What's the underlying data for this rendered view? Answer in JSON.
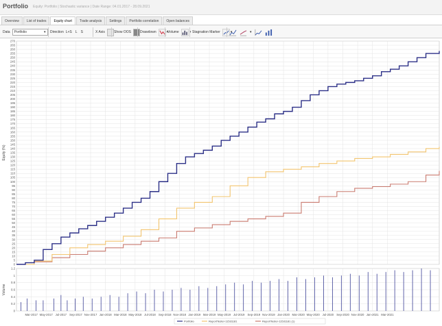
{
  "window": {
    "title": "Portfolio",
    "subtitle": "Equity: Portfolio | Stochastic variance | Date Range: 04.01.2017 - 28.09.2021"
  },
  "tabs": [
    {
      "label": "Overview",
      "active": false
    },
    {
      "label": "List of trades",
      "active": false
    },
    {
      "label": "Equity chart",
      "active": true
    },
    {
      "label": "Trade analysis",
      "active": false
    },
    {
      "label": "Settings",
      "active": false
    },
    {
      "label": "Portfolio correlation",
      "active": false
    },
    {
      "label": "Open balances",
      "active": false
    }
  ],
  "toolbar": {
    "data_label": "Data",
    "data_value": "Portfolio",
    "direction_label": "Direction",
    "direction_values": [
      "L+S",
      "L",
      "S"
    ],
    "xaxis_label": "X Axis",
    "show_oos_label": "Show OOS",
    "drawdown_label": "Drawdown",
    "volume_label": "Volume",
    "stagnation_label": "Stagnation Marker"
  },
  "colors": {
    "portfolio": "#2b2f86",
    "series2": "#f2c46e",
    "series3": "#c97a6f",
    "volume_bar": "#3a3f95",
    "grid": "#e3e3e3"
  },
  "chart_data": [
    {
      "type": "line",
      "ylabel": "Equity (%)",
      "ylim": [
        0,
        270
      ],
      "yticks": [
        0,
        5,
        10,
        15,
        20,
        25,
        30,
        35,
        40,
        45,
        50,
        55,
        60,
        65,
        70,
        75,
        80,
        85,
        90,
        95,
        100,
        105,
        110,
        115,
        120,
        125,
        130,
        135,
        140,
        145,
        150,
        155,
        160,
        165,
        170,
        175,
        180,
        185,
        190,
        195,
        200,
        205,
        210,
        215,
        220,
        225,
        230,
        235,
        240,
        245,
        250,
        255,
        260,
        265,
        270
      ],
      "xlim": [
        2017.0,
        2021.75
      ],
      "x_tick_labels": [
        "Mar-2017",
        "May-2017",
        "Jul-2017",
        "Sep-2017",
        "Nov-2017",
        "Jan-2018",
        "Mar-2018",
        "May-2018",
        "Jul-2018",
        "Sep-2018",
        "Nov-2018",
        "Jan-2019",
        "Mar-2019",
        "May-2019",
        "Jul-2019",
        "Sep-2019",
        "Nov-2019",
        "Jan-2020",
        "Mar-2020",
        "May-2020",
        "Jul-2020",
        "Sep-2020",
        "Nov-2020",
        "Jan-2021",
        "Mar-2021"
      ],
      "x_tick_values": [
        2017.167,
        2017.333,
        2017.5,
        2017.667,
        2017.833,
        2018.0,
        2018.167,
        2018.333,
        2018.5,
        2018.667,
        2018.833,
        2019.0,
        2019.167,
        2019.333,
        2019.5,
        2019.667,
        2019.833,
        2020.0,
        2020.167,
        2020.333,
        2020.5,
        2020.667,
        2020.833,
        2021.0,
        2021.167
      ],
      "grid": true,
      "legend": "bottom-right",
      "series": [
        {
          "name": "Portfolio",
          "color_key": "portfolio",
          "x": [
            2017.0,
            2017.1,
            2017.2,
            2017.3,
            2017.4,
            2017.5,
            2017.6,
            2017.7,
            2017.8,
            2017.9,
            2018.0,
            2018.1,
            2018.2,
            2018.3,
            2018.4,
            2018.5,
            2018.6,
            2018.7,
            2018.8,
            2018.9,
            2019.0,
            2019.1,
            2019.2,
            2019.3,
            2019.4,
            2019.5,
            2019.6,
            2019.7,
            2019.8,
            2019.9,
            2020.0,
            2020.1,
            2020.2,
            2020.3,
            2020.4,
            2020.5,
            2020.6,
            2020.7,
            2020.8,
            2020.9,
            2021.0,
            2021.1,
            2021.2,
            2021.3,
            2021.4,
            2021.5,
            2021.6,
            2021.75
          ],
          "y": [
            0,
            2,
            5,
            18,
            25,
            33,
            38,
            43,
            47,
            52,
            57,
            62,
            68,
            75,
            80,
            88,
            100,
            110,
            122,
            130,
            134,
            138,
            143,
            150,
            155,
            160,
            166,
            172,
            176,
            182,
            185,
            190,
            198,
            205,
            210,
            215,
            218,
            220,
            222,
            225,
            228,
            233,
            236,
            240,
            245,
            250,
            255,
            258
          ]
        },
        {
          "name": "ReportTester-11531181",
          "color_key": "series2",
          "x": [
            2017.0,
            2017.2,
            2017.4,
            2017.6,
            2017.8,
            2018.0,
            2018.2,
            2018.4,
            2018.6,
            2018.8,
            2019.0,
            2019.2,
            2019.4,
            2019.6,
            2019.8,
            2020.0,
            2020.2,
            2020.4,
            2020.6,
            2020.8,
            2021.0,
            2021.2,
            2021.4,
            2021.6,
            2021.75
          ],
          "y": [
            0,
            4,
            12,
            20,
            24,
            28,
            34,
            42,
            55,
            68,
            75,
            82,
            95,
            105,
            112,
            115,
            118,
            122,
            125,
            128,
            130,
            133,
            136,
            140,
            142
          ]
        },
        {
          "name": "ReportTester-11531181 (1)",
          "color_key": "series3",
          "x": [
            2017.0,
            2017.2,
            2017.4,
            2017.6,
            2017.8,
            2018.0,
            2018.2,
            2018.4,
            2018.6,
            2018.8,
            2019.0,
            2019.2,
            2019.4,
            2019.6,
            2019.8,
            2020.0,
            2020.2,
            2020.4,
            2020.6,
            2020.8,
            2021.0,
            2021.2,
            2021.4,
            2021.6,
            2021.75
          ],
          "y": [
            0,
            3,
            8,
            12,
            16,
            20,
            24,
            28,
            32,
            40,
            44,
            48,
            52,
            55,
            58,
            62,
            75,
            82,
            88,
            92,
            94,
            97,
            100,
            108,
            113
          ]
        }
      ]
    },
    {
      "type": "bar",
      "ylabel": "Volume",
      "ylim": [
        0,
        1.2
      ],
      "yticks": [
        0,
        0.2,
        0.4,
        0.6,
        0.8,
        1,
        1.2
      ],
      "volume_ticks": [
        {
          "x": 2017.05,
          "v": 0.25
        },
        {
          "x": 2017.12,
          "v": 0.35
        },
        {
          "x": 2017.22,
          "v": 0.3
        },
        {
          "x": 2017.3,
          "v": 0.3
        },
        {
          "x": 2017.42,
          "v": 0.35
        },
        {
          "x": 2017.5,
          "v": 0.45
        },
        {
          "x": 2017.57,
          "v": 0.3
        },
        {
          "x": 2017.66,
          "v": 0.35
        },
        {
          "x": 2017.75,
          "v": 0.4
        },
        {
          "x": 2017.85,
          "v": 0.35
        },
        {
          "x": 2017.95,
          "v": 0.4
        },
        {
          "x": 2018.05,
          "v": 0.45
        },
        {
          "x": 2018.15,
          "v": 0.4
        },
        {
          "x": 2018.25,
          "v": 0.5
        },
        {
          "x": 2018.35,
          "v": 0.55
        },
        {
          "x": 2018.45,
          "v": 0.5
        },
        {
          "x": 2018.55,
          "v": 0.6
        },
        {
          "x": 2018.65,
          "v": 0.55
        },
        {
          "x": 2018.75,
          "v": 0.6
        },
        {
          "x": 2018.85,
          "v": 0.65
        },
        {
          "x": 2018.95,
          "v": 0.6
        },
        {
          "x": 2019.05,
          "v": 0.7
        },
        {
          "x": 2019.15,
          "v": 0.65
        },
        {
          "x": 2019.25,
          "v": 0.7
        },
        {
          "x": 2019.35,
          "v": 0.75
        },
        {
          "x": 2019.45,
          "v": 0.8
        },
        {
          "x": 2019.55,
          "v": 0.75
        },
        {
          "x": 2019.65,
          "v": 0.85
        },
        {
          "x": 2019.75,
          "v": 0.8
        },
        {
          "x": 2019.85,
          "v": 0.85
        },
        {
          "x": 2019.95,
          "v": 0.9
        },
        {
          "x": 2020.05,
          "v": 0.85
        },
        {
          "x": 2020.15,
          "v": 0.95
        },
        {
          "x": 2020.25,
          "v": 0.9
        },
        {
          "x": 2020.35,
          "v": 0.95
        },
        {
          "x": 2020.45,
          "v": 1.0
        },
        {
          "x": 2020.55,
          "v": 0.95
        },
        {
          "x": 2020.65,
          "v": 1.0
        },
        {
          "x": 2020.75,
          "v": 1.05
        },
        {
          "x": 2020.85,
          "v": 1.0
        },
        {
          "x": 2020.95,
          "v": 1.1
        },
        {
          "x": 2021.05,
          "v": 1.05
        },
        {
          "x": 2021.15,
          "v": 1.1
        },
        {
          "x": 2021.25,
          "v": 1.15
        },
        {
          "x": 2021.35,
          "v": 1.1
        },
        {
          "x": 2021.45,
          "v": 1.15
        },
        {
          "x": 2021.55,
          "v": 1.2
        },
        {
          "x": 2021.65,
          "v": 1.15
        }
      ]
    }
  ]
}
